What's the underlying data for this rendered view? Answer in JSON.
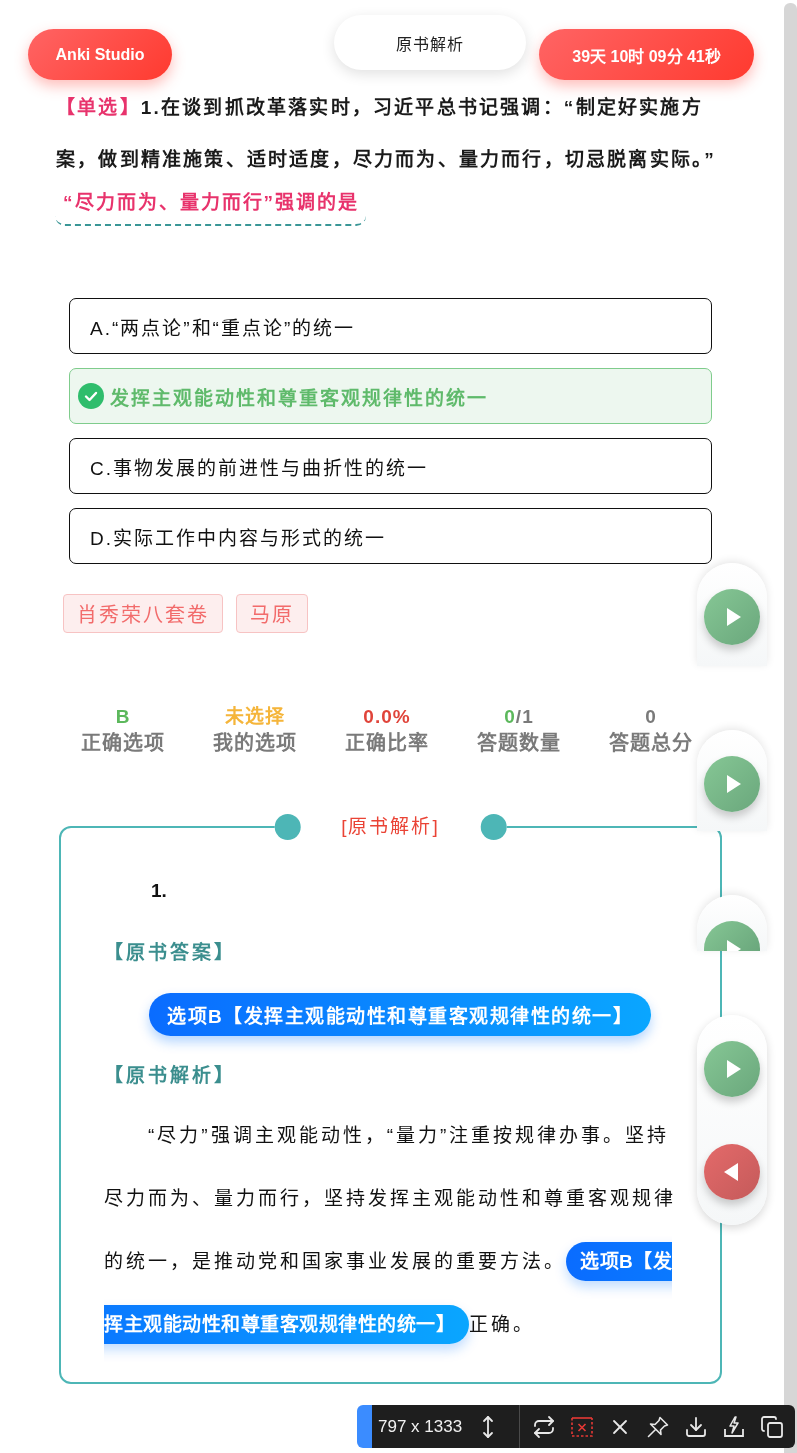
{
  "header": {
    "brand": "Anki Studio",
    "title": "原书解析",
    "countdown": "39天 10时 09分 41秒"
  },
  "question": {
    "type_tag": "【单选】",
    "text": "1.在谈到抓改革落实时，习近平总书记强调：“制定好实施方案，做到精准施策、适时适度，尽力而为、量力而行，切忌脱离实际。”",
    "prompt": "“尽力而为、量力而行”强调的是"
  },
  "options": [
    {
      "letter": "A.",
      "text": "“两点论”和“重点论”的统一",
      "correct": false
    },
    {
      "text": "发挥主观能动性和尊重客观规律性的统一",
      "correct": true
    },
    {
      "letter": "C.",
      "text": "事物发展的前进性与曲折性的统一",
      "correct": false
    },
    {
      "letter": "D.",
      "text": "实际工作中内容与形式的统一",
      "correct": false
    }
  ],
  "tags": [
    "肖秀荣八套卷",
    "马原"
  ],
  "stats": [
    {
      "value": "B",
      "color": "#5cb85c",
      "label": "正确选项"
    },
    {
      "value": "未选择",
      "color": "#f5b53a",
      "label": "我的选项"
    },
    {
      "value": "0.0%",
      "color": "#e0443a",
      "label": "正确比率"
    },
    {
      "value": "0",
      "color": "#5cb85c",
      "suffix": "/1",
      "label": "答题数量"
    },
    {
      "value": "0",
      "color": "#7a7a7a",
      "label": "答题总分"
    }
  ],
  "analysis": {
    "title": "[原书解析]",
    "number": "1.",
    "answer_heading": "【原书答案】",
    "answer": "选项B【发挥主观能动性和尊重客观规律性的统一】",
    "explanation_heading": "【原书解析】",
    "explanation": [
      {
        "text": "“尽力”强调主观能动性，“量力”注重按规律办事。坚持尽力而为、量力而行，坚持发挥主观能动性和尊重客观规律的统一，是推动党和国家事业发展的重要方法。",
        "highlight": false
      },
      {
        "text": "选项B【发挥主观能动性和尊重客观规律性的统一】",
        "highlight": true
      },
      {
        "text": "正确。",
        "highlight": false
      }
    ]
  },
  "nav_panels": [
    {
      "buttons": [
        {
          "kind": "next"
        }
      ]
    },
    {
      "buttons": [
        {
          "kind": "next"
        }
      ]
    },
    {
      "buttons": [
        {
          "kind": "next"
        }
      ]
    },
    {
      "buttons": [
        {
          "kind": "next"
        },
        {
          "kind": "previous"
        }
      ]
    }
  ],
  "capture_toolbar": {
    "size": "797 x 1333"
  }
}
